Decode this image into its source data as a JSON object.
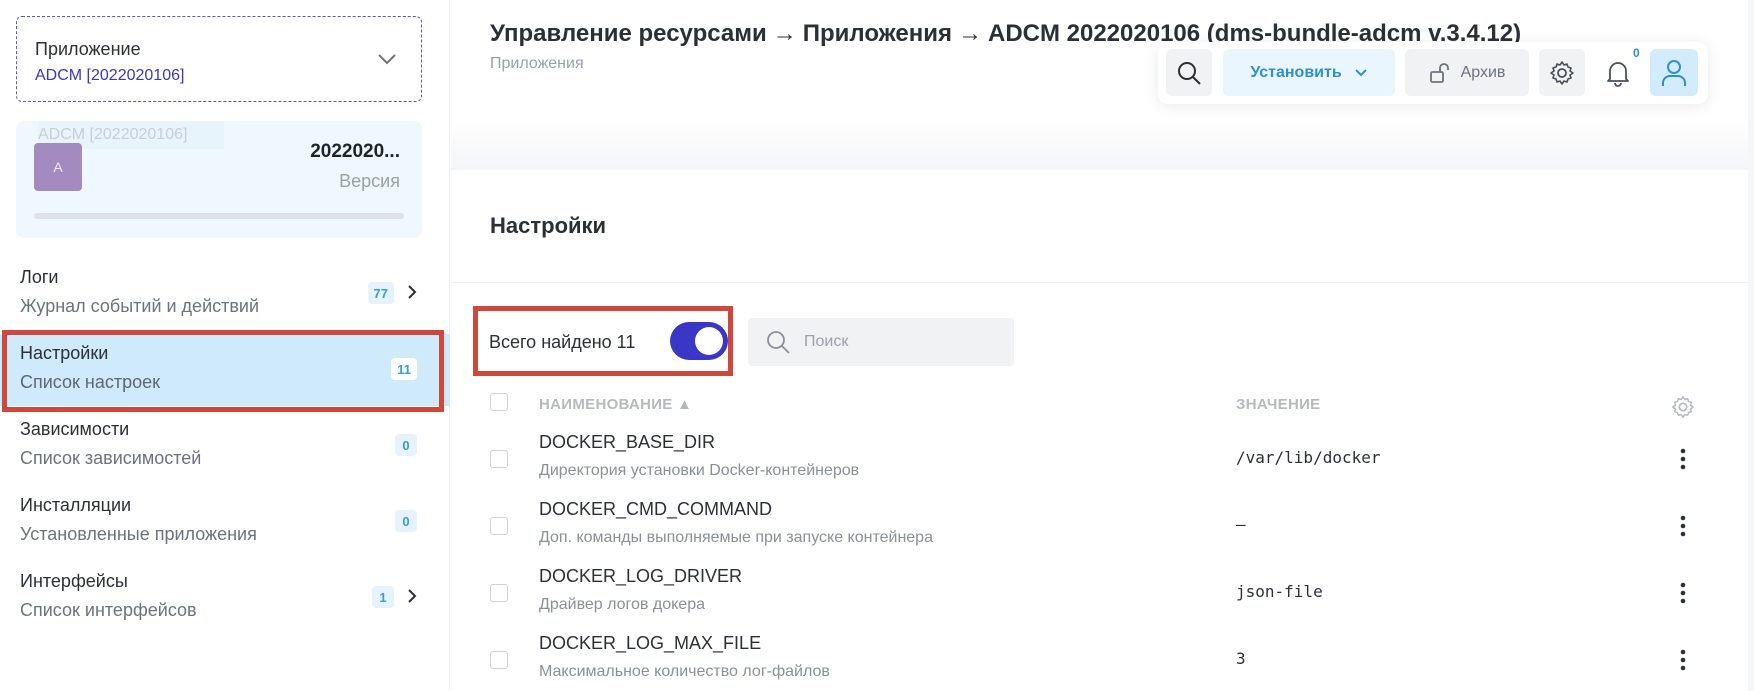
{
  "sidebar": {
    "app_select": {
      "label": "Приложение",
      "value": "ADCM [2022020106]"
    },
    "app_card": {
      "ghost_label": "ADCM [2022020106]",
      "avatar_letter": "A",
      "version_number": "2022020...",
      "version_label": "Версия"
    },
    "items": [
      {
        "title": "Логи",
        "subtitle": "Журнал событий и действий",
        "count": "77",
        "has_arrow": true,
        "active": false
      },
      {
        "title": "Настройки",
        "subtitle": "Список настроек",
        "count": "11",
        "has_arrow": false,
        "active": true
      },
      {
        "title": "Зависимости",
        "subtitle": "Список зависимостей",
        "count": "0",
        "has_arrow": false,
        "active": false
      },
      {
        "title": "Инсталляции",
        "subtitle": "Установленные приложения",
        "count": "0",
        "has_arrow": false,
        "active": false
      },
      {
        "title": "Интерфейсы",
        "subtitle": "Список интерфейсов",
        "count": "1",
        "has_arrow": true,
        "active": false
      }
    ]
  },
  "header": {
    "breadcrumb": [
      "Управление ресурсами",
      "Приложения",
      "ADCM 2022020106 (dms-bundle-adcm v.3.4.12)"
    ],
    "separator": "→",
    "subtitle": "Приложения"
  },
  "toolbar": {
    "install_label": "Установить",
    "archive_label": "Архив",
    "notifications_count": "0"
  },
  "section": {
    "title": "Настройки"
  },
  "filters": {
    "found_text": "Всего найдено 11",
    "toggle_on": true,
    "search_placeholder": "Поиск"
  },
  "table": {
    "columns": {
      "name": "НАИМЕНОВАНИЕ ▲",
      "value": "ЗНАЧЕНИЕ"
    },
    "rows": [
      {
        "name": "DOCKER_BASE_DIR",
        "description": "Директория установки Docker-контейнеров",
        "value": "/var/lib/docker"
      },
      {
        "name": "DOCKER_CMD_COMMAND",
        "description": "Доп. команды выполняемые при запуске контейнера",
        "value": "—"
      },
      {
        "name": "DOCKER_LOG_DRIVER",
        "description": "Драйвер логов докера",
        "value": "json-file"
      },
      {
        "name": "DOCKER_LOG_MAX_FILE",
        "description": "Максимальное количество лог-файлов",
        "value": "3"
      }
    ]
  },
  "colors": {
    "accent": "#3a36c6",
    "highlight": "#d0473c",
    "active_nav": "#cfeafb",
    "badge_text": "#3a9bd8"
  },
  "icons": {
    "chevron": "chevron-down-icon",
    "search": "search-icon",
    "lock": "unlock-icon",
    "gear": "gear-icon",
    "bell": "bell-icon",
    "user": "user-icon",
    "kebab": "kebab-menu-icon"
  }
}
